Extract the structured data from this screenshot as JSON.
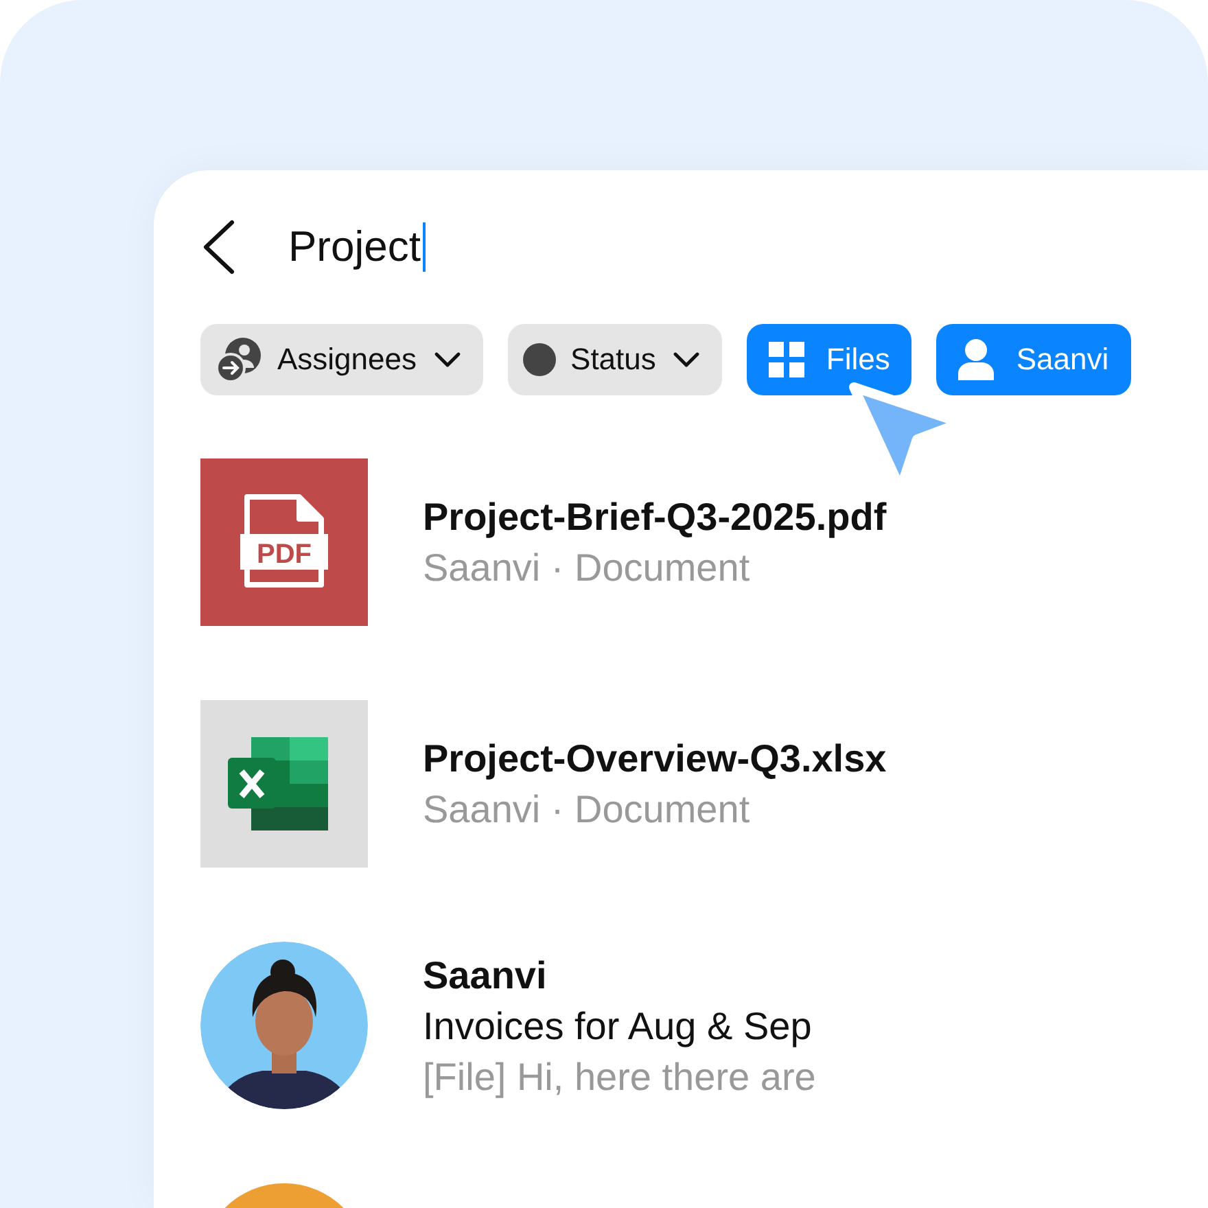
{
  "search": {
    "value": "Project"
  },
  "filters": [
    {
      "kind": "people",
      "label": "Assignees",
      "dropdown": true,
      "selected": false
    },
    {
      "kind": "dot",
      "label": "Status",
      "dropdown": true,
      "selected": false
    },
    {
      "kind": "grid",
      "label": "Files",
      "dropdown": false,
      "selected": true
    },
    {
      "kind": "person",
      "label": "Saanvi",
      "dropdown": false,
      "selected": true
    }
  ],
  "results": [
    {
      "kind": "pdf",
      "thumb_label": "PDF",
      "title": "Project-Brief-Q3-2025.pdf",
      "subtitle": "Saanvi · Document"
    },
    {
      "kind": "xlsx",
      "title": "Project-Overview-Q3.xlsx",
      "subtitle": "Saanvi · Document"
    },
    {
      "kind": "message",
      "title": "Saanvi",
      "line": "Invoices for Aug & Sep",
      "subtitle": "[File] Hi, here there are"
    },
    {
      "kind": "color-avatar",
      "color": "#ee9f33"
    }
  ]
}
